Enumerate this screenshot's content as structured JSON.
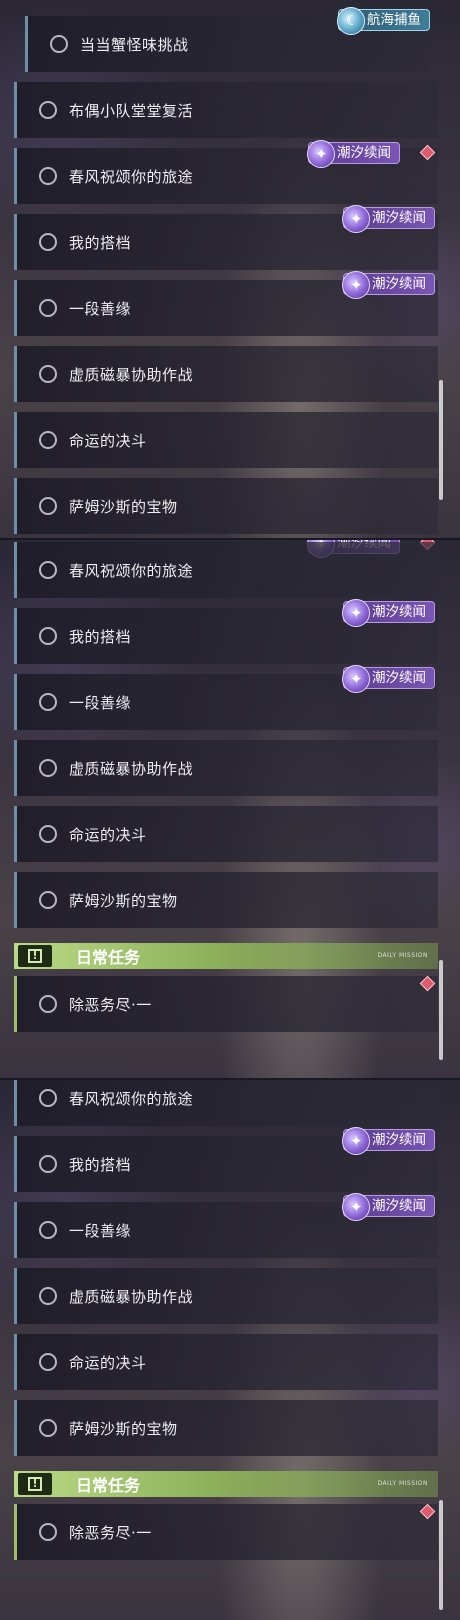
{
  "tags": {
    "tide": "潮汐续闻",
    "sea": "航海捕鱼"
  },
  "section": {
    "daily_title": "日常任务",
    "deco_text": "DAILY MISSION"
  },
  "quests": {
    "q_crab": "当当蟹怪味挑战",
    "q_buou": "布偶小队堂堂复活",
    "q_spring": "春风祝颂你的旅途",
    "q_partner": "我的搭档",
    "q_fate_bond": "一段善缘",
    "q_storm": "虚质磁暴协助作战",
    "q_duel": "命运的决斗",
    "q_treasure": "萨姆沙斯的宝物",
    "q_daily": "除恶务尽·一"
  }
}
